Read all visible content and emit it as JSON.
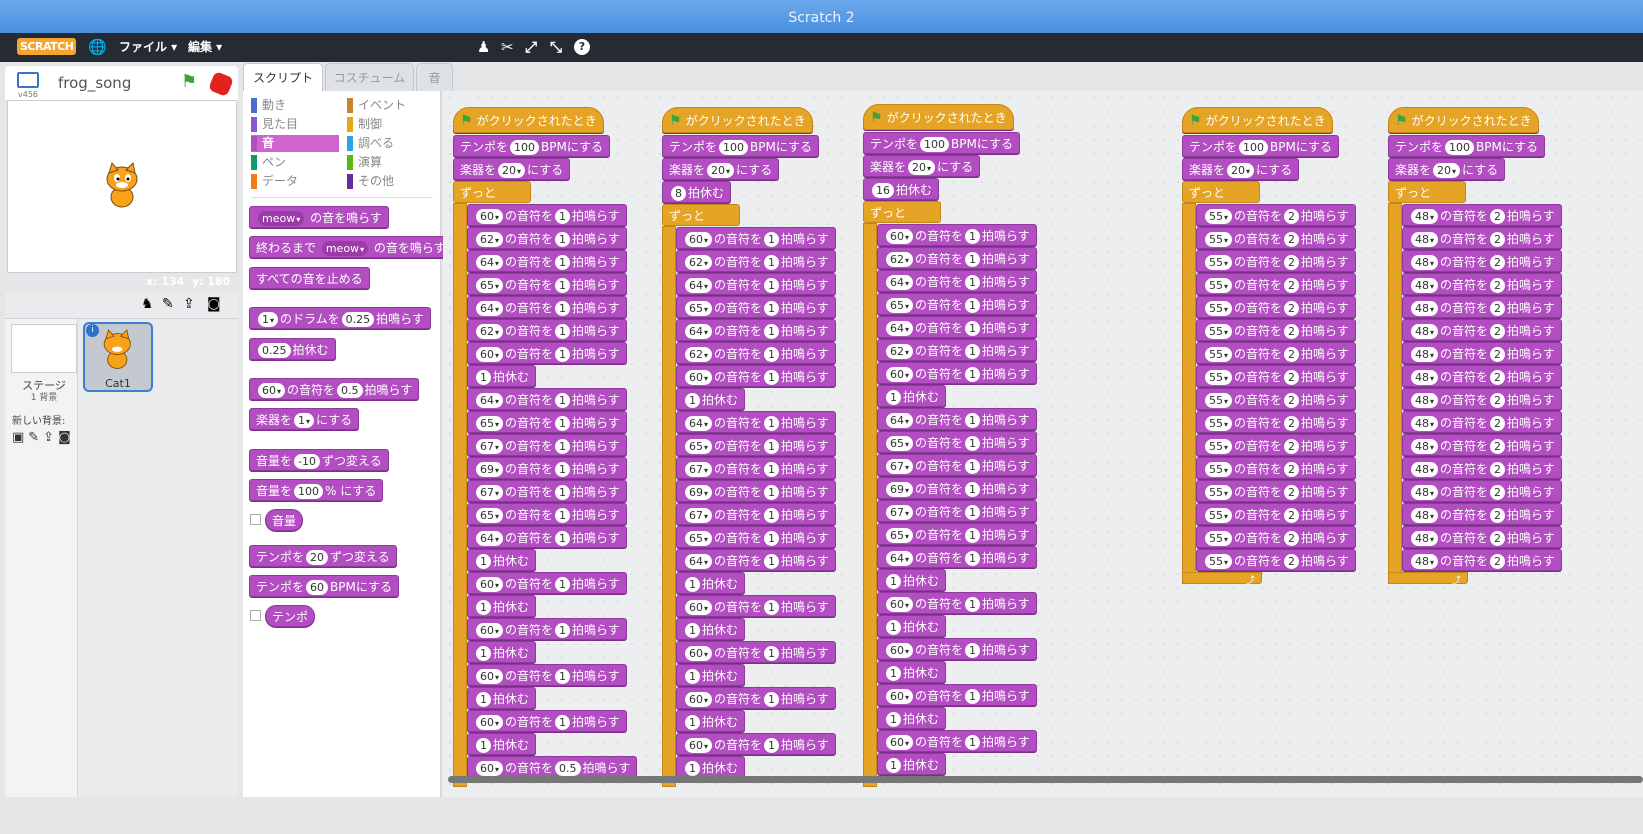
{
  "window": {
    "title": "Scratch 2"
  },
  "menu": {
    "logo": "SCRATCH",
    "file": "ファイル ▾",
    "edit": "編集 ▾"
  },
  "toolbar": {
    "duplicate": "♟",
    "cut": "✂",
    "grow": "⤢",
    "shrink": "⤡",
    "help": "?"
  },
  "stage": {
    "version": "v456",
    "project_name": "frog_song",
    "x_label": "x: 134",
    "y_label": "y: 180"
  },
  "sprites": {
    "stage_label": "ステージ",
    "stage_sub": "1 背景",
    "new_backdrop": "新しい背景:",
    "sprite_name": "Cat1"
  },
  "tabs": {
    "scripts": "スクリプト",
    "costumes": "コスチューム",
    "sounds": "音"
  },
  "categories": {
    "motion": "動き",
    "looks": "見た目",
    "sound": "音",
    "pen": "ペン",
    "data": "データ",
    "events": "イベント",
    "control": "制御",
    "sensing": "調べる",
    "operators": "演算",
    "more": "その他"
  },
  "palette": {
    "play_sound": {
      "v": "meow",
      "t": "の音を鳴らす"
    },
    "play_until": {
      "a": "終わるまで",
      "v": "meow",
      "t": "の音を鳴らす"
    },
    "stop_all": "すべての音を止める",
    "drum": {
      "v": "1",
      "a": "のドラムを",
      "b": "0.25",
      "t": "拍鳴らす"
    },
    "rest": {
      "v": "0.25",
      "t": "拍休む"
    },
    "note": {
      "v": "60",
      "a": "の音符を",
      "b": "0.5",
      "t": "拍鳴らす"
    },
    "instrument": {
      "a": "楽器を",
      "v": "1",
      "t": "にする"
    },
    "change_volume": {
      "a": "音量を",
      "v": "-10",
      "t": "ずつ変える"
    },
    "set_volume": {
      "a": "音量を",
      "v": "100",
      "t": "% にする"
    },
    "volume": "音量",
    "change_tempo": {
      "a": "テンポを",
      "v": "20",
      "t": "ずつ変える"
    },
    "set_tempo": {
      "a": "テンポを",
      "v": "60",
      "t": "BPMにする"
    },
    "tempo": "テンポ"
  },
  "script": {
    "hat": "がクリックされたとき",
    "tempo_a": "テンポを",
    "tempo_v": "100",
    "tempo_t": "BPMにする",
    "inst_a": "楽器を",
    "inst_v": "20",
    "inst_t": "にする",
    "forever": "ずっと",
    "note_a": "の音符を",
    "note_t": "拍鳴らす",
    "rest_t": "拍休む",
    "col1": [
      [
        "n",
        "60",
        "1"
      ],
      [
        "n",
        "62",
        "1"
      ],
      [
        "n",
        "64",
        "1"
      ],
      [
        "n",
        "65",
        "1"
      ],
      [
        "n",
        "64",
        "1"
      ],
      [
        "n",
        "62",
        "1"
      ],
      [
        "n",
        "60",
        "1"
      ],
      [
        "r",
        "1"
      ],
      [
        "n",
        "64",
        "1"
      ],
      [
        "n",
        "65",
        "1"
      ],
      [
        "n",
        "67",
        "1"
      ],
      [
        "n",
        "69",
        "1"
      ],
      [
        "n",
        "67",
        "1"
      ],
      [
        "n",
        "65",
        "1"
      ],
      [
        "n",
        "64",
        "1"
      ],
      [
        "r",
        "1"
      ],
      [
        "n",
        "60",
        "1"
      ],
      [
        "r",
        "1"
      ],
      [
        "n",
        "60",
        "1"
      ],
      [
        "r",
        "1"
      ],
      [
        "n",
        "60",
        "1"
      ],
      [
        "r",
        "1"
      ],
      [
        "n",
        "60",
        "1"
      ],
      [
        "r",
        "1"
      ],
      [
        "n",
        "60",
        "0.5"
      ]
    ],
    "col2_rest": "8",
    "col2": [
      [
        "n",
        "60",
        "1"
      ],
      [
        "n",
        "62",
        "1"
      ],
      [
        "n",
        "64",
        "1"
      ],
      [
        "n",
        "65",
        "1"
      ],
      [
        "n",
        "64",
        "1"
      ],
      [
        "n",
        "62",
        "1"
      ],
      [
        "n",
        "60",
        "1"
      ],
      [
        "r",
        "1"
      ],
      [
        "n",
        "64",
        "1"
      ],
      [
        "n",
        "65",
        "1"
      ],
      [
        "n",
        "67",
        "1"
      ],
      [
        "n",
        "69",
        "1"
      ],
      [
        "n",
        "67",
        "1"
      ],
      [
        "n",
        "65",
        "1"
      ],
      [
        "n",
        "64",
        "1"
      ],
      [
        "r",
        "1"
      ],
      [
        "n",
        "60",
        "1"
      ],
      [
        "r",
        "1"
      ],
      [
        "n",
        "60",
        "1"
      ],
      [
        "r",
        "1"
      ],
      [
        "n",
        "60",
        "1"
      ],
      [
        "r",
        "1"
      ],
      [
        "n",
        "60",
        "1"
      ],
      [
        "r",
        "1"
      ]
    ],
    "col3_rest": "16",
    "col3": [
      [
        "n",
        "60",
        "1"
      ],
      [
        "n",
        "62",
        "1"
      ],
      [
        "n",
        "64",
        "1"
      ],
      [
        "n",
        "65",
        "1"
      ],
      [
        "n",
        "64",
        "1"
      ],
      [
        "n",
        "62",
        "1"
      ],
      [
        "n",
        "60",
        "1"
      ],
      [
        "r",
        "1"
      ],
      [
        "n",
        "64",
        "1"
      ],
      [
        "n",
        "65",
        "1"
      ],
      [
        "n",
        "67",
        "1"
      ],
      [
        "n",
        "69",
        "1"
      ],
      [
        "n",
        "67",
        "1"
      ],
      [
        "n",
        "65",
        "1"
      ],
      [
        "n",
        "64",
        "1"
      ],
      [
        "r",
        "1"
      ],
      [
        "n",
        "60",
        "1"
      ],
      [
        "r",
        "1"
      ],
      [
        "n",
        "60",
        "1"
      ],
      [
        "r",
        "1"
      ],
      [
        "n",
        "60",
        "1"
      ],
      [
        "r",
        "1"
      ],
      [
        "n",
        "60",
        "1"
      ],
      [
        "r",
        "1"
      ]
    ],
    "col4": [
      [
        "n",
        "55",
        "2"
      ],
      [
        "n",
        "55",
        "2"
      ],
      [
        "n",
        "55",
        "2"
      ],
      [
        "n",
        "55",
        "2"
      ],
      [
        "n",
        "55",
        "2"
      ],
      [
        "n",
        "55",
        "2"
      ],
      [
        "n",
        "55",
        "2"
      ],
      [
        "n",
        "55",
        "2"
      ],
      [
        "n",
        "55",
        "2"
      ],
      [
        "n",
        "55",
        "2"
      ],
      [
        "n",
        "55",
        "2"
      ],
      [
        "n",
        "55",
        "2"
      ],
      [
        "n",
        "55",
        "2"
      ],
      [
        "n",
        "55",
        "2"
      ],
      [
        "n",
        "55",
        "2"
      ],
      [
        "n",
        "55",
        "2"
      ]
    ],
    "col5": [
      [
        "n",
        "48",
        "2"
      ],
      [
        "n",
        "48",
        "2"
      ],
      [
        "n",
        "48",
        "2"
      ],
      [
        "n",
        "48",
        "2"
      ],
      [
        "n",
        "48",
        "2"
      ],
      [
        "n",
        "48",
        "2"
      ],
      [
        "n",
        "48",
        "2"
      ],
      [
        "n",
        "48",
        "2"
      ],
      [
        "n",
        "48",
        "2"
      ],
      [
        "n",
        "48",
        "2"
      ],
      [
        "n",
        "48",
        "2"
      ],
      [
        "n",
        "48",
        "2"
      ],
      [
        "n",
        "48",
        "2"
      ],
      [
        "n",
        "48",
        "2"
      ],
      [
        "n",
        "48",
        "2"
      ],
      [
        "n",
        "48",
        "2"
      ]
    ]
  }
}
